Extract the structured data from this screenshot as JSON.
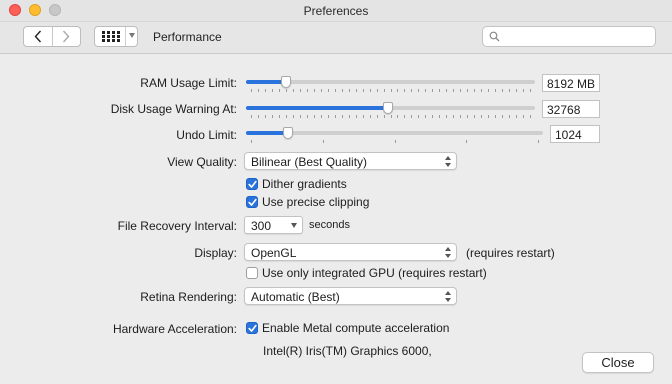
{
  "window": {
    "title": "Preferences"
  },
  "toolbar": {
    "pane_title": "Performance",
    "search_placeholder": ""
  },
  "settings": {
    "ram_usage": {
      "label": "RAM Usage Limit:",
      "value": "8192 MB",
      "fraction": 0.14
    },
    "disk_usage": {
      "label": "Disk Usage Warning At:",
      "value": "32768",
      "fraction": 0.49
    },
    "undo_limit": {
      "label": "Undo Limit:",
      "value": "1024",
      "fraction": 0.14
    },
    "view_quality": {
      "label": "View Quality:",
      "selected": "Bilinear (Best Quality)"
    },
    "dither_gradients": {
      "label": "Dither gradients",
      "checked": true
    },
    "precise_clipping": {
      "label": "Use precise clipping",
      "checked": true
    },
    "file_recovery": {
      "label": "File Recovery Interval:",
      "selected": "300",
      "unit": "seconds"
    },
    "display": {
      "label": "Display:",
      "selected": "OpenGL",
      "note": "(requires restart)"
    },
    "integrated_gpu": {
      "label": "Use only integrated GPU (requires restart)",
      "checked": false
    },
    "retina_rendering": {
      "label": "Retina Rendering:",
      "selected": "Automatic (Best)"
    },
    "hardware_acceleration": {
      "label": "Hardware Acceleration:",
      "checkbox_label": "Enable Metal compute acceleration",
      "checked": true,
      "gpu_name": "Intel(R) Iris(TM) Graphics 6000,"
    }
  },
  "buttons": {
    "close": "Close"
  },
  "colors": {
    "accent": "#2a72dc",
    "window_bg": "#ececec"
  }
}
